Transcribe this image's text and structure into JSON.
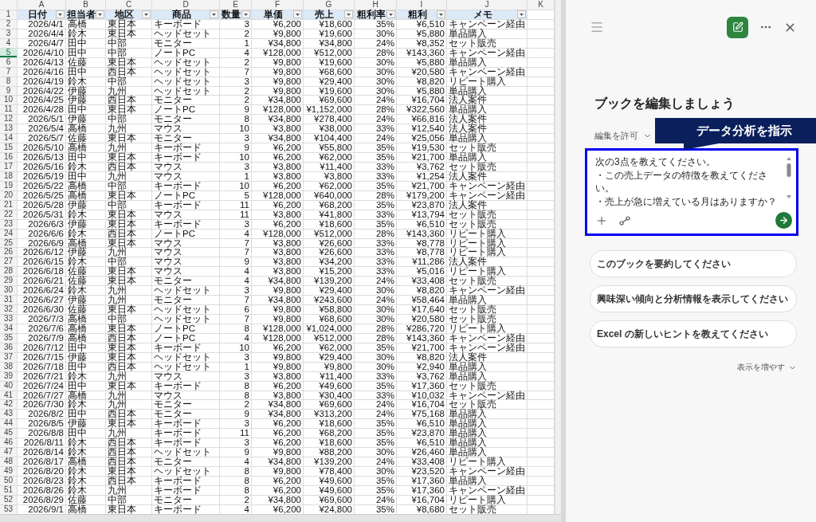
{
  "sheet": {
    "column_letters": [
      "A",
      "B",
      "C",
      "D",
      "E",
      "F",
      "G",
      "H",
      "I",
      "J",
      "K"
    ],
    "header_row": {
      "n": "1",
      "headings": [
        "日付",
        "担当者",
        "地区",
        "商品",
        "数量",
        "単価",
        "売上",
        "粗利率",
        "粗利",
        "メモ"
      ]
    },
    "rows": [
      {
        "n": "2",
        "selected": false,
        "cells": [
          "2026/4/1",
          "高橋",
          "東日本",
          "キーボード",
          "3",
          "¥6,200",
          "¥18,600",
          "35%",
          "¥6,510",
          "キャンペーン経由"
        ]
      },
      {
        "n": "3",
        "selected": false,
        "cells": [
          "2026/4/4",
          "鈴木",
          "東日本",
          "ヘッドセット",
          "2",
          "¥9,800",
          "¥19,600",
          "30%",
          "¥5,880",
          "単品購入"
        ]
      },
      {
        "n": "4",
        "selected": false,
        "cells": [
          "2026/4/7",
          "田中",
          "中部",
          "モニター",
          "1",
          "¥34,800",
          "¥34,800",
          "24%",
          "¥8,352",
          "セット販売"
        ]
      },
      {
        "n": "5",
        "selected": true,
        "cells": [
          "2026/4/10",
          "田中",
          "中部",
          "ノートPC",
          "4",
          "¥128,000",
          "¥512,000",
          "28%",
          "¥143,360",
          "キャンペーン経由"
        ]
      },
      {
        "n": "6",
        "selected": false,
        "cells": [
          "2026/4/13",
          "佐藤",
          "東日本",
          "ヘッドセット",
          "2",
          "¥9,800",
          "¥19,600",
          "30%",
          "¥5,880",
          "単品購入"
        ]
      },
      {
        "n": "7",
        "selected": false,
        "cells": [
          "2026/4/16",
          "田中",
          "西日本",
          "ヘッドセット",
          "7",
          "¥9,800",
          "¥68,600",
          "30%",
          "¥20,580",
          "キャンペーン経由"
        ]
      },
      {
        "n": "8",
        "selected": false,
        "cells": [
          "2026/4/19",
          "鈴木",
          "中部",
          "ヘッドセット",
          "3",
          "¥9,800",
          "¥29,400",
          "30%",
          "¥8,820",
          "リピート購入"
        ]
      },
      {
        "n": "9",
        "selected": false,
        "cells": [
          "2026/4/22",
          "伊藤",
          "九州",
          "ヘッドセット",
          "2",
          "¥9,800",
          "¥19,600",
          "30%",
          "¥5,880",
          "単品購入"
        ]
      },
      {
        "n": "10",
        "selected": false,
        "cells": [
          "2026/4/25",
          "伊藤",
          "西日本",
          "モニター",
          "2",
          "¥34,800",
          "¥69,600",
          "24%",
          "¥16,704",
          "法人案件"
        ]
      },
      {
        "n": "11",
        "selected": false,
        "cells": [
          "2026/4/28",
          "田中",
          "東日本",
          "ノートPC",
          "9",
          "¥128,000",
          "¥1,152,000",
          "28%",
          "¥322,560",
          "単品購入"
        ]
      },
      {
        "n": "12",
        "selected": false,
        "cells": [
          "2026/5/1",
          "伊藤",
          "中部",
          "モニター",
          "8",
          "¥34,800",
          "¥278,400",
          "24%",
          "¥66,816",
          "法人案件"
        ]
      },
      {
        "n": "13",
        "selected": false,
        "cells": [
          "2026/5/4",
          "高橋",
          "九州",
          "マウス",
          "10",
          "¥3,800",
          "¥38,000",
          "33%",
          "¥12,540",
          "法人案件"
        ]
      },
      {
        "n": "14",
        "selected": false,
        "cells": [
          "2026/5/7",
          "佐藤",
          "東日本",
          "モニター",
          "3",
          "¥34,800",
          "¥104,400",
          "24%",
          "¥25,056",
          "単品購入"
        ]
      },
      {
        "n": "15",
        "selected": false,
        "cells": [
          "2026/5/10",
          "高橋",
          "九州",
          "キーボード",
          "9",
          "¥6,200",
          "¥55,800",
          "35%",
          "¥19,530",
          "セット販売"
        ]
      },
      {
        "n": "16",
        "selected": false,
        "cells": [
          "2026/5/13",
          "田中",
          "東日本",
          "キーボード",
          "10",
          "¥6,200",
          "¥62,000",
          "35%",
          "¥21,700",
          "単品購入"
        ]
      },
      {
        "n": "17",
        "selected": false,
        "cells": [
          "2026/5/16",
          "鈴木",
          "西日本",
          "マウス",
          "3",
          "¥3,800",
          "¥11,400",
          "33%",
          "¥3,762",
          "セット販売"
        ]
      },
      {
        "n": "18",
        "selected": false,
        "cells": [
          "2026/5/19",
          "田中",
          "九州",
          "マウス",
          "1",
          "¥3,800",
          "¥3,800",
          "33%",
          "¥1,254",
          "法人案件"
        ]
      },
      {
        "n": "19",
        "selected": false,
        "cells": [
          "2026/5/22",
          "高橋",
          "中部",
          "キーボード",
          "10",
          "¥6,200",
          "¥62,000",
          "35%",
          "¥21,700",
          "キャンペーン経由"
        ]
      },
      {
        "n": "20",
        "selected": false,
        "cells": [
          "2026/5/25",
          "高橋",
          "東日本",
          "ノートPC",
          "5",
          "¥128,000",
          "¥640,000",
          "28%",
          "¥179,200",
          "キャンペーン経由"
        ]
      },
      {
        "n": "21",
        "selected": false,
        "cells": [
          "2026/5/28",
          "伊藤",
          "中部",
          "キーボード",
          "11",
          "¥6,200",
          "¥68,200",
          "35%",
          "¥23,870",
          "法人案件"
        ]
      },
      {
        "n": "22",
        "selected": false,
        "cells": [
          "2026/5/31",
          "鈴木",
          "東日本",
          "マウス",
          "11",
          "¥3,800",
          "¥41,800",
          "33%",
          "¥13,794",
          "セット販売"
        ]
      },
      {
        "n": "23",
        "selected": false,
        "cells": [
          "2026/6/3",
          "伊藤",
          "東日本",
          "キーボード",
          "3",
          "¥6,200",
          "¥18,600",
          "35%",
          "¥6,510",
          "セット販売"
        ]
      },
      {
        "n": "24",
        "selected": false,
        "cells": [
          "2026/6/6",
          "鈴木",
          "西日本",
          "ノートPC",
          "4",
          "¥128,000",
          "¥512,000",
          "28%",
          "¥143,360",
          "リピート購入"
        ]
      },
      {
        "n": "25",
        "selected": false,
        "cells": [
          "2026/6/9",
          "高橋",
          "東日本",
          "マウス",
          "7",
          "¥3,800",
          "¥26,600",
          "33%",
          "¥8,778",
          "リピート購入"
        ]
      },
      {
        "n": "26",
        "selected": false,
        "cells": [
          "2026/6/12",
          "伊藤",
          "九州",
          "マウス",
          "7",
          "¥3,800",
          "¥26,600",
          "33%",
          "¥8,778",
          "リピート購入"
        ]
      },
      {
        "n": "27",
        "selected": false,
        "cells": [
          "2026/6/15",
          "鈴木",
          "中部",
          "マウス",
          "9",
          "¥3,800",
          "¥34,200",
          "33%",
          "¥11,286",
          "法人案件"
        ]
      },
      {
        "n": "28",
        "selected": false,
        "cells": [
          "2026/6/18",
          "佐藤",
          "東日本",
          "マウス",
          "4",
          "¥3,800",
          "¥15,200",
          "33%",
          "¥5,016",
          "リピート購入"
        ]
      },
      {
        "n": "29",
        "selected": false,
        "cells": [
          "2026/6/21",
          "佐藤",
          "東日本",
          "モニター",
          "4",
          "¥34,800",
          "¥139,200",
          "24%",
          "¥33,408",
          "セット販売"
        ]
      },
      {
        "n": "30",
        "selected": false,
        "cells": [
          "2026/6/24",
          "鈴木",
          "九州",
          "ヘッドセット",
          "3",
          "¥9,800",
          "¥29,400",
          "30%",
          "¥8,820",
          "キャンペーン経由"
        ]
      },
      {
        "n": "31",
        "selected": false,
        "cells": [
          "2026/6/27",
          "伊藤",
          "九州",
          "モニター",
          "7",
          "¥34,800",
          "¥243,600",
          "24%",
          "¥58,464",
          "単品購入"
        ]
      },
      {
        "n": "32",
        "selected": false,
        "cells": [
          "2026/6/30",
          "佐藤",
          "東日本",
          "ヘッドセット",
          "6",
          "¥9,800",
          "¥58,800",
          "30%",
          "¥17,640",
          "セット販売"
        ]
      },
      {
        "n": "33",
        "selected": false,
        "cells": [
          "2026/7/3",
          "高橋",
          "中部",
          "ヘッドセット",
          "7",
          "¥9,800",
          "¥68,600",
          "30%",
          "¥20,580",
          "セット販売"
        ]
      },
      {
        "n": "34",
        "selected": false,
        "cells": [
          "2026/7/6",
          "高橋",
          "東日本",
          "ノートPC",
          "8",
          "¥128,000",
          "¥1,024,000",
          "28%",
          "¥286,720",
          "リピート購入"
        ]
      },
      {
        "n": "35",
        "selected": false,
        "cells": [
          "2026/7/9",
          "高橋",
          "西日本",
          "ノートPC",
          "4",
          "¥128,000",
          "¥512,000",
          "28%",
          "¥143,360",
          "キャンペーン経由"
        ]
      },
      {
        "n": "36",
        "selected": false,
        "cells": [
          "2026/7/12",
          "田中",
          "東日本",
          "キーボード",
          "10",
          "¥6,200",
          "¥62,000",
          "35%",
          "¥21,700",
          "キャンペーン経由"
        ]
      },
      {
        "n": "37",
        "selected": false,
        "cells": [
          "2026/7/15",
          "伊藤",
          "東日本",
          "ヘッドセット",
          "3",
          "¥9,800",
          "¥29,400",
          "30%",
          "¥8,820",
          "法人案件"
        ]
      },
      {
        "n": "38",
        "selected": false,
        "cells": [
          "2026/7/18",
          "田中",
          "西日本",
          "ヘッドセット",
          "1",
          "¥9,800",
          "¥9,800",
          "30%",
          "¥2,940",
          "単品購入"
        ]
      },
      {
        "n": "39",
        "selected": false,
        "cells": [
          "2026/7/21",
          "鈴木",
          "九州",
          "マウス",
          "3",
          "¥3,800",
          "¥11,400",
          "33%",
          "¥3,762",
          "単品購入"
        ]
      },
      {
        "n": "40",
        "selected": false,
        "cells": [
          "2026/7/24",
          "田中",
          "東日本",
          "キーボード",
          "8",
          "¥6,200",
          "¥49,600",
          "35%",
          "¥17,360",
          "セット販売"
        ]
      },
      {
        "n": "41",
        "selected": false,
        "cells": [
          "2026/7/27",
          "高橋",
          "九州",
          "マウス",
          "8",
          "¥3,800",
          "¥30,400",
          "33%",
          "¥10,032",
          "キャンペーン経由"
        ]
      },
      {
        "n": "42",
        "selected": false,
        "cells": [
          "2026/7/30",
          "鈴木",
          "九州",
          "モニター",
          "2",
          "¥34,800",
          "¥69,600",
          "24%",
          "¥16,704",
          "セット販売"
        ]
      },
      {
        "n": "43",
        "selected": false,
        "cells": [
          "2026/8/2",
          "田中",
          "西日本",
          "モニター",
          "9",
          "¥34,800",
          "¥313,200",
          "24%",
          "¥75,168",
          "単品購入"
        ]
      },
      {
        "n": "44",
        "selected": false,
        "cells": [
          "2026/8/5",
          "伊藤",
          "東日本",
          "キーボード",
          "3",
          "¥6,200",
          "¥18,600",
          "35%",
          "¥6,510",
          "単品購入"
        ]
      },
      {
        "n": "45",
        "selected": false,
        "cells": [
          "2026/8/8",
          "田中",
          "九州",
          "キーボード",
          "11",
          "¥6,200",
          "¥68,200",
          "35%",
          "¥23,870",
          "単品購入"
        ]
      },
      {
        "n": "46",
        "selected": false,
        "cells": [
          "2026/8/11",
          "鈴木",
          "西日本",
          "キーボード",
          "3",
          "¥6,200",
          "¥18,600",
          "35%",
          "¥6,510",
          "単品購入"
        ]
      },
      {
        "n": "47",
        "selected": false,
        "cells": [
          "2026/8/14",
          "鈴木",
          "西日本",
          "ヘッドセット",
          "9",
          "¥9,800",
          "¥88,200",
          "30%",
          "¥26,460",
          "単品購入"
        ]
      },
      {
        "n": "48",
        "selected": false,
        "cells": [
          "2026/8/17",
          "高橋",
          "西日本",
          "モニター",
          "4",
          "¥34,800",
          "¥139,200",
          "24%",
          "¥33,408",
          "リピート購入"
        ]
      },
      {
        "n": "49",
        "selected": false,
        "cells": [
          "2026/8/20",
          "鈴木",
          "東日本",
          "ヘッドセット",
          "8",
          "¥9,800",
          "¥78,400",
          "30%",
          "¥23,520",
          "キャンペーン経由"
        ]
      },
      {
        "n": "50",
        "selected": false,
        "cells": [
          "2026/8/23",
          "鈴木",
          "西日本",
          "キーボード",
          "8",
          "¥6,200",
          "¥49,600",
          "35%",
          "¥17,360",
          "単品購入"
        ]
      },
      {
        "n": "51",
        "selected": false,
        "cells": [
          "2026/8/26",
          "鈴木",
          "九州",
          "キーボード",
          "8",
          "¥6,200",
          "¥49,600",
          "35%",
          "¥17,360",
          "キャンペーン経由"
        ]
      },
      {
        "n": "52",
        "selected": false,
        "cells": [
          "2026/8/29",
          "佐藤",
          "中部",
          "モニター",
          "2",
          "¥34,800",
          "¥69,600",
          "24%",
          "¥16,704",
          "リピート購入"
        ]
      },
      {
        "n": "53",
        "selected": false,
        "cells": [
          "2026/9/1",
          "高橋",
          "東日本",
          "キーボード",
          "4",
          "¥6,200",
          "¥24,800",
          "35%",
          "¥8,680",
          "セット販売"
        ]
      }
    ]
  },
  "copilot": {
    "title": "ブックを編集しましょう",
    "permission": "編集を許可",
    "prompt": {
      "lines": [
        "次の3点を教えてください。",
        "・この売上データの特徴を教えてください。",
        "・売上が急に増えている月はありますか？"
      ]
    },
    "suggestions": [
      "このブックを要約してください",
      "興味深い傾向と分析情報を表示してください",
      "Excel の新しいヒントを教えてください"
    ],
    "more": "表示を増やす"
  },
  "callout": {
    "label": "データ分析を指示"
  }
}
